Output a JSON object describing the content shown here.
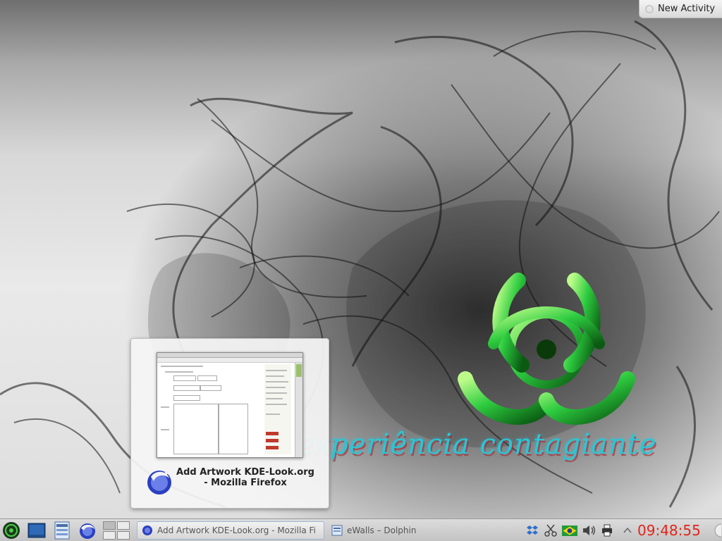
{
  "desktop": {
    "slogan": "experiência contagiante",
    "new_activity_label": "New Activity"
  },
  "tooltip": {
    "window_title": "Add  Artwork KDE-Look.org - Mozilla Firefox"
  },
  "taskbar": {
    "launchers": [
      {
        "icon": "biohazard-menu-icon"
      },
      {
        "icon": "desktop-icon"
      },
      {
        "icon": "file-manager-icon"
      },
      {
        "icon": "firefox-icon"
      }
    ],
    "pager_desktops": 4,
    "tasks": [
      {
        "label": "Add  Artwork KDE-Look.org - Mozilla Fi",
        "icon": "firefox-icon",
        "active": true
      },
      {
        "label": "eWalls – Dolphin",
        "icon": "dolphin-icon",
        "active": false
      }
    ],
    "tray": [
      {
        "icon": "dropbox-icon"
      },
      {
        "icon": "klipper-scissors-icon"
      },
      {
        "icon": "brazil-flag-icon"
      },
      {
        "icon": "volume-icon"
      },
      {
        "icon": "printer-icon"
      },
      {
        "icon": "tray-expand-arrow-icon"
      }
    ],
    "clock": "09:48:55"
  },
  "colors": {
    "slogan": "#29c6d6",
    "clock": "#e0251b",
    "biohazard": "#2ecc40"
  }
}
